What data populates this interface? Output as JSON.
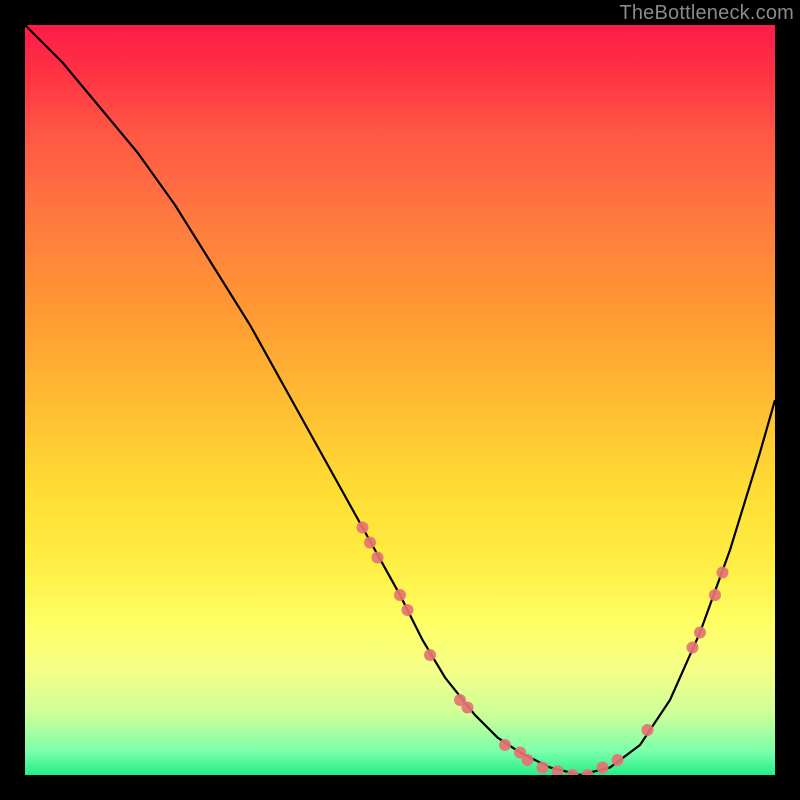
{
  "watermark": "TheBottleneck.com",
  "chart_data": {
    "type": "line",
    "title": "",
    "xlabel": "",
    "ylabel": "",
    "xlim": [
      0,
      100
    ],
    "ylim": [
      0,
      100
    ],
    "grid": false,
    "curve": {
      "x": [
        0,
        5,
        10,
        15,
        20,
        25,
        30,
        35,
        40,
        45,
        50,
        53,
        56,
        60,
        63,
        66,
        70,
        74,
        78,
        82,
        86,
        90,
        94,
        98,
        100
      ],
      "y": [
        100,
        95,
        89,
        83,
        76,
        68,
        60,
        51,
        42,
        33,
        24,
        18,
        13,
        8,
        5,
        3,
        1,
        0,
        1,
        4,
        10,
        19,
        30,
        43,
        50
      ]
    },
    "markers": [
      {
        "x": 45,
        "y": 33
      },
      {
        "x": 46,
        "y": 31
      },
      {
        "x": 47,
        "y": 29
      },
      {
        "x": 50,
        "y": 24
      },
      {
        "x": 51,
        "y": 22
      },
      {
        "x": 54,
        "y": 16
      },
      {
        "x": 58,
        "y": 10
      },
      {
        "x": 59,
        "y": 9
      },
      {
        "x": 64,
        "y": 4
      },
      {
        "x": 66,
        "y": 3
      },
      {
        "x": 67,
        "y": 2
      },
      {
        "x": 69,
        "y": 1
      },
      {
        "x": 71,
        "y": 0.5
      },
      {
        "x": 73,
        "y": 0
      },
      {
        "x": 75,
        "y": 0
      },
      {
        "x": 77,
        "y": 1
      },
      {
        "x": 79,
        "y": 2
      },
      {
        "x": 83,
        "y": 6
      },
      {
        "x": 89,
        "y": 17
      },
      {
        "x": 90,
        "y": 19
      },
      {
        "x": 92,
        "y": 24
      },
      {
        "x": 93,
        "y": 27
      }
    ]
  }
}
